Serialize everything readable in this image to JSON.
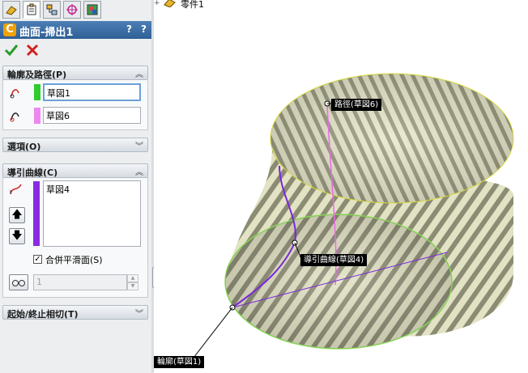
{
  "tree": {
    "root_label": "零件1"
  },
  "feature": {
    "title": "曲面-掃出1",
    "help_glyph": "?",
    "help_glyph2": "?"
  },
  "sections": {
    "profile_path": {
      "header": "輪廓及路徑(P)",
      "profile_value": "草図1",
      "path_value": "草図6",
      "profile_color": "#2ecc2e",
      "path_color": "#ee88ee"
    },
    "options": {
      "header": "選項(O)"
    },
    "guide_curves": {
      "header": "導引曲線(C)",
      "items": [
        "草図4"
      ],
      "guide_color": "#8a2be2",
      "merge_label": "合併平滑面(S)",
      "merge_checked": true,
      "spin_value": "1"
    },
    "tangency": {
      "header": "起始/終止相切(T)"
    }
  },
  "callouts": {
    "path": "路徑(草図6)",
    "guide": "導引曲線(草図4)",
    "profile": "輪廓(草図1)"
  },
  "colors": {
    "title_bar": "#3a6ea5",
    "ok": "#2a9a2a",
    "cancel": "#d22020",
    "profile_edge": "#8ee05a",
    "guide_curve": "#7a28d8",
    "path_curve": "#ee66ee"
  },
  "icons": [
    "part-icon",
    "feature-manager-icon",
    "property-manager-icon",
    "configuration-manager-icon",
    "dimxpert-icon",
    "display-manager-icon",
    "ok-icon",
    "cancel-icon",
    "profile-select-icon",
    "path-select-icon",
    "guide-curve-icon",
    "move-up-icon",
    "move-down-icon",
    "show-sections-icon"
  ]
}
